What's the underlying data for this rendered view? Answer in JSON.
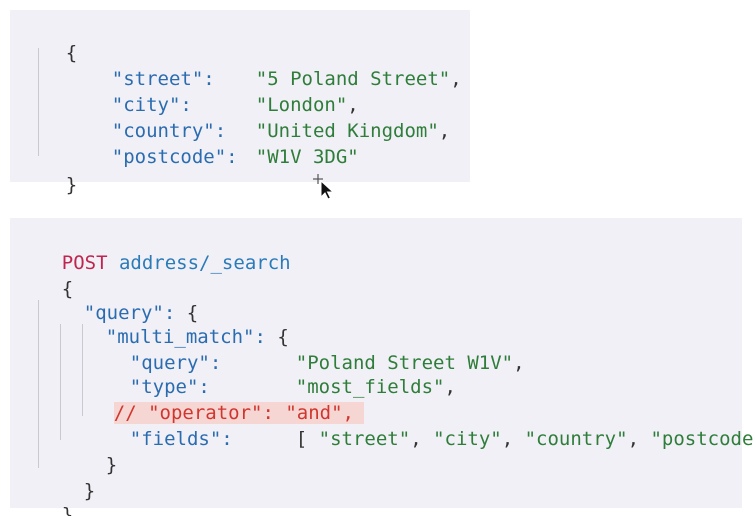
{
  "address_doc": {
    "open_brace": "{",
    "close_brace": "}",
    "fields": [
      {
        "key": "\"street\":",
        "value": "\"5 Poland Street\"",
        "trail": ","
      },
      {
        "key": "\"city\":",
        "value": "\"London\"",
        "trail": ","
      },
      {
        "key": "\"country\":",
        "value": "\"United Kingdom\"",
        "trail": ","
      },
      {
        "key": "\"postcode\":",
        "value": "\"W1V 3DG\"",
        "trail": ""
      }
    ]
  },
  "search_request": {
    "method": "POST",
    "endpoint": "address/_search",
    "open_brace": "{",
    "query_key": "\"query\":",
    "query_open": "{",
    "multi_match_key": "\"multi_match\":",
    "multi_match_open": "{",
    "params": {
      "query": {
        "key": "\"query\":",
        "value": "\"Poland Street W1V\"",
        "trail": ","
      },
      "type": {
        "key": "\"type\":",
        "value": "\"most_fields\"",
        "trail": ","
      },
      "operator_comment": "// \"operator\": \"and\",",
      "fields": {
        "key": "\"fields\":",
        "open_bracket": "[",
        "values": [
          "\"street\"",
          "\"city\"",
          "\"country\"",
          "\"postcode\""
        ],
        "close_bracket": "]"
      }
    },
    "multi_match_close": "}",
    "query_close": "}",
    "close_brace": "}"
  },
  "icons": {
    "cursor": "move-cursor-icon"
  },
  "colors": {
    "panel_bg": "#f0f0f6",
    "key": "#2b6cb0",
    "string": "#2f7d3a",
    "method": "#c0254f",
    "comment": "#d0362f",
    "comment_bg": "#f6d6d3"
  }
}
